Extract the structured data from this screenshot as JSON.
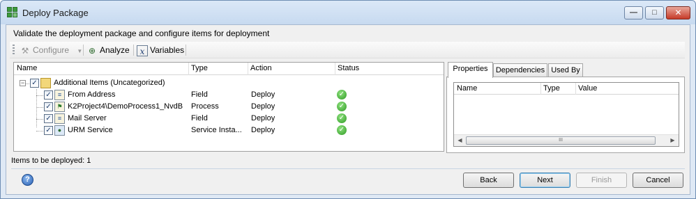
{
  "window": {
    "title": "Deploy Package",
    "controls": {
      "minimize": "—",
      "maximize": "□",
      "close": "✕"
    }
  },
  "prompt": "Validate the deployment package and configure items for deployment",
  "toolbar": {
    "configure": "Configure",
    "analyze": "Analyze",
    "variables": "Variables"
  },
  "tree": {
    "columns": [
      "Name",
      "Type",
      "Action",
      "Status"
    ],
    "root": {
      "name": "Additional Items (Uncategorized)",
      "checked": true
    },
    "rows": [
      {
        "name": "From Address",
        "type": "Field",
        "action": "Deploy",
        "status": "ok"
      },
      {
        "name": "K2Project4\\DemoProcess1_NvdB",
        "type": "Process",
        "action": "Deploy",
        "status": "ok"
      },
      {
        "name": "Mail Server",
        "type": "Field",
        "action": "Deploy",
        "status": "ok"
      },
      {
        "name": "URM Service",
        "type": "Service Insta...",
        "action": "Deploy",
        "status": "ok"
      }
    ]
  },
  "items_to_deploy": "Items to be deployed: 1",
  "tabs": [
    "Properties",
    "Dependencies",
    "Used By"
  ],
  "properties": {
    "columns": [
      "Name",
      "Type",
      "Value"
    ],
    "scroll_thumb": "III"
  },
  "buttons": {
    "back": "Back",
    "next": "Next",
    "finish": "Finish",
    "cancel": "Cancel"
  },
  "help_glyph": "?",
  "icons": [
    "app-icon",
    "configure-icon",
    "analyze-icon",
    "variables-icon",
    "folder-icon",
    "field-icon",
    "process-icon",
    "service-icon",
    "check-ok-icon",
    "help-icon"
  ],
  "colors": {
    "status_ok": "#2f9a24",
    "accent": "#3c7fb1",
    "titlebar": "#c7daf0"
  }
}
